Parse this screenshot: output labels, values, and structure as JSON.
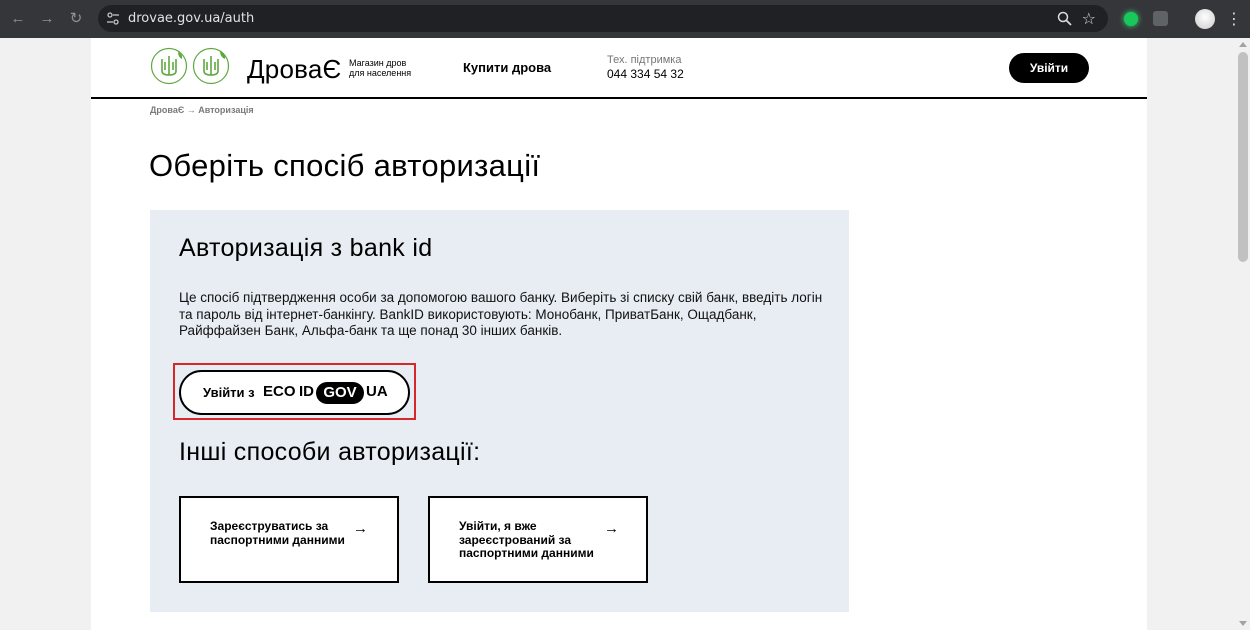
{
  "browser": {
    "url": "drovae.gov.ua/auth",
    "back_icon": "arrow-left-icon",
    "forward_icon": "arrow-right-icon",
    "reload_icon": "reload-icon"
  },
  "header": {
    "brand": "ДроваЄ",
    "brand_sub_1": "Магазин дров",
    "brand_sub_2": "для населення",
    "nav_buy": "Купити дрова",
    "support_label": "Тех. підтримка",
    "support_phone": "044 334 54 32",
    "login_label": "Увійти"
  },
  "breadcrumb": "ДроваЄ → Авторизація",
  "page_title": "Оберіть спосіб авторизації",
  "bankid": {
    "title": "Авторизація з bank id",
    "description": "Це спосіб підтвердження особи за допомогою вашого банку. Виберіть зі списку свій банк, введіть логін та пароль від інтернет-банкінгу. BankID використовують: Монобанк, ПриватБанк, Ощадбанк, Райффайзен Банк, Альфа-банк та ще понад 30 інших банків.",
    "button_prefix": "Увійти з",
    "logo_part_1": "ECO",
    "logo_part_2": "ID",
    "logo_part_3": "GOV",
    "logo_part_4": "UA"
  },
  "other": {
    "title": "Інші способи авторизації:",
    "register_label": "Зареєструватись за паспортними данними",
    "login_passport_label": "Увійти, я вже зареєстрований за паспортними данними",
    "arrow": "→"
  },
  "colors": {
    "accent_green": "#5fa83f",
    "panel_bg": "#e7edf3",
    "highlight_red": "#d6272b"
  }
}
